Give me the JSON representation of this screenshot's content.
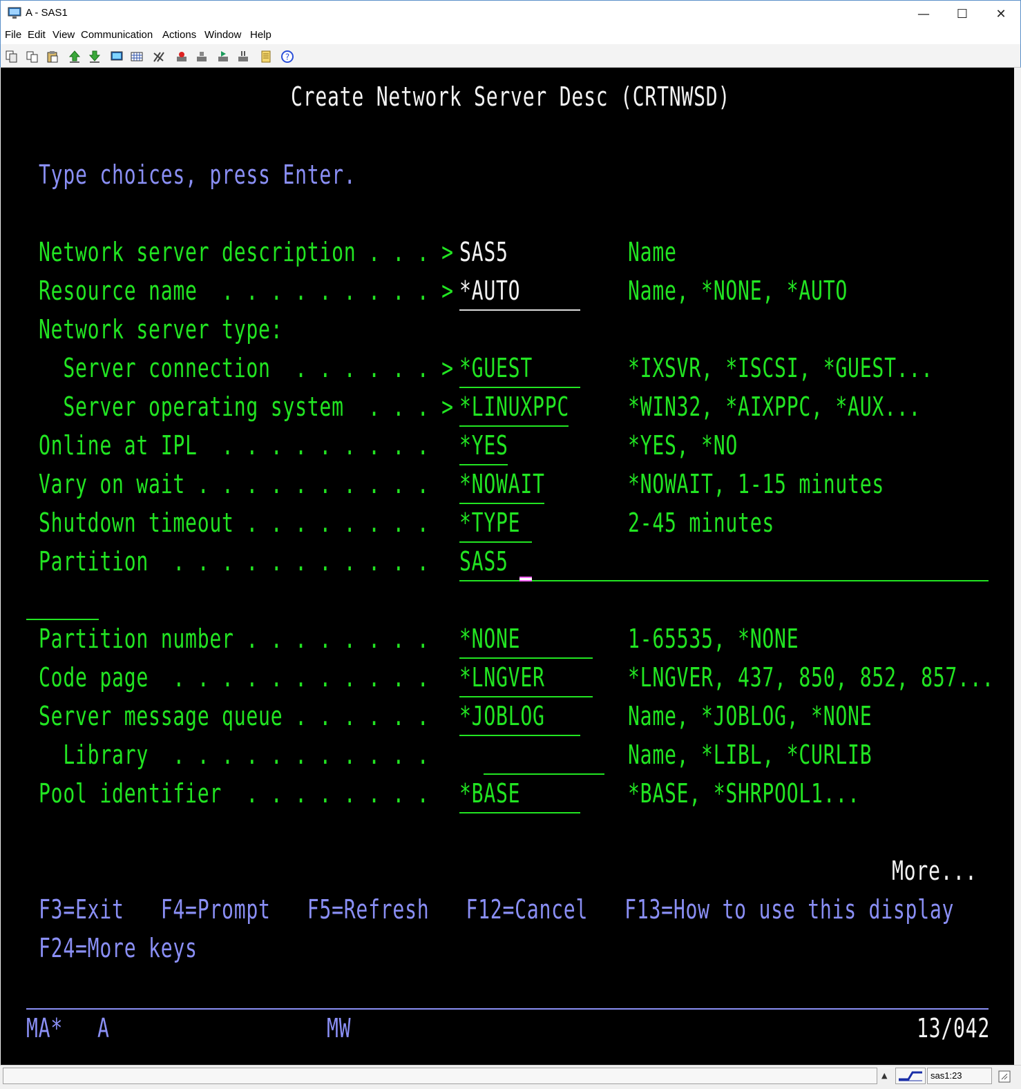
{
  "window": {
    "title": "A - SAS1",
    "minimize": "—",
    "maximize": "☐",
    "close": "✕"
  },
  "menu": {
    "items": [
      "File",
      "Edit",
      "View",
      "Communication",
      "Actions",
      "Window",
      "Help"
    ]
  },
  "toolbar": {
    "icons": [
      "copy-icon",
      "paste-icon",
      "clipboard-icon",
      "upload-icon",
      "download-icon",
      "display-icon",
      "keypad-icon",
      "macro-icon",
      "record-icon",
      "stop-icon",
      "play-icon",
      "pause-icon",
      "notes-icon",
      "help-icon"
    ]
  },
  "screen": {
    "title": "Create Network Server Desc (CRTNWSD)",
    "instruction": "Type choices, press Enter.",
    "fields": [
      {
        "label": "Network server description . . . >",
        "value": "SAS5",
        "hint": "Name"
      },
      {
        "label": "Resource name  . . . . . . . . . >",
        "value": "*AUTO",
        "hint": "Name, *NONE, *AUTO"
      },
      {
        "label": "Network server type:",
        "value": "",
        "hint": ""
      },
      {
        "label": "  Server connection  . . . . . . >",
        "value": "*GUEST",
        "hint": "*IXSVR, *ISCSI, *GUEST..."
      },
      {
        "label": "  Server operating system  . . . >",
        "value": "*LINUXPPC",
        "hint": "*WIN32, *AIXPPC, *AUX..."
      },
      {
        "label": "Online at IPL  . . . . . . . . .",
        "value": "*YES",
        "hint": "*YES, *NO"
      },
      {
        "label": "Vary on wait . . . . . . . . . .",
        "value": "*NOWAIT",
        "hint": "*NOWAIT, 1-15 minutes"
      },
      {
        "label": "Shutdown timeout . . . . . . . .",
        "value": "*TYPE",
        "hint": "2-45 minutes"
      },
      {
        "label": "Partition  . . . . . . . . . . .",
        "value": "SAS5",
        "hint": ""
      },
      {
        "label": "Partition number . . . . . . . .",
        "value": "*NONE",
        "hint": "1-65535, *NONE"
      },
      {
        "label": "Code page  . . . . . . . . . . .",
        "value": "*LNGVER",
        "hint": "*LNGVER, 437, 850, 852, 857..."
      },
      {
        "label": "Server message queue . . . . . .",
        "value": "*JOBLOG",
        "hint": "Name, *JOBLOG, *NONE"
      },
      {
        "label": "  Library  . . . . . . . . . . .",
        "value": "",
        "hint": "Name, *LIBL, *CURLIB"
      },
      {
        "label": "Pool identifier  . . . . . . . .",
        "value": "*BASE",
        "hint": "*BASE, *SHRPOOL1..."
      }
    ],
    "more": "More...",
    "fkeys_line1": "F3=Exit   F4=Prompt   F5=Refresh   F12=Cancel   F13=How to use this display",
    "fkeys_line2": "F24=More keys",
    "oia": {
      "left": "MA*",
      "session": "A",
      "mode": "MW",
      "cursor_pos": "13/042"
    }
  },
  "statusbar": {
    "session": "sas1:23"
  },
  "colors": {
    "field_green": "#22e522",
    "input_white": "#f2f2f2",
    "text_blue": "#8a8ff5",
    "background": "#000000"
  }
}
